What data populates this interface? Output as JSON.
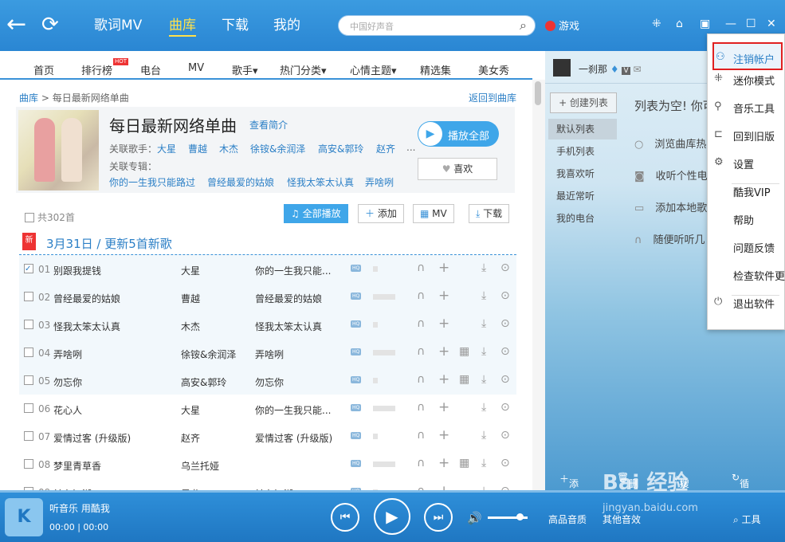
{
  "topbar": {
    "tabs": [
      "歌词MV",
      "曲库",
      "下载",
      "我的"
    ],
    "search_placeholder": "中国好声音",
    "game_label": "游戏"
  },
  "catbar": {
    "items": [
      "首页",
      "排行榜",
      "电台",
      "MV",
      "歌手▾",
      "热门分类▾",
      "心情主题▾",
      "精选集",
      "美女秀"
    ],
    "hot_badge": "HOT"
  },
  "main": {
    "breadcrumb_root": "曲库",
    "breadcrumb_sep": " > ",
    "breadcrumb_current": "每日最新网络单曲",
    "back_link": "返回到曲库",
    "title": "每日最新网络单曲",
    "intro_link": "查看简介",
    "related_singers_label": "关联歌手：",
    "related_singers": [
      "大星",
      "曹越",
      "木杰",
      "徐铵&余润泽",
      "高安&郭玲",
      "赵齐",
      "..."
    ],
    "related_albums_label": "关联专辑：",
    "related_albums": [
      "你的一生我只能路过",
      "曾经最爱的姑娘",
      "怪我太笨太认真",
      "弄啥咧"
    ],
    "play_all": "播放全部",
    "like": "喜欢",
    "count": "共302首",
    "toolbar": {
      "play_all": "全部播放",
      "add": "添加",
      "mv": "MV",
      "download": "下载"
    },
    "new_tag": "新",
    "date_title": "3月31日 / 更新5首新歌",
    "songs": [
      {
        "num": "01",
        "name": "别跟我提钱",
        "singer": "大星",
        "album": "你的一生我只能...",
        "mv": false
      },
      {
        "num": "02",
        "name": "曾经最爱的姑娘",
        "singer": "曹越",
        "album": "曾经最爱的姑娘",
        "mv": false
      },
      {
        "num": "03",
        "name": "怪我太笨太认真",
        "singer": "木杰",
        "album": "怪我太笨太认真",
        "mv": false
      },
      {
        "num": "04",
        "name": "弄啥咧",
        "singer": "徐铵&余润泽",
        "album": "弄啥咧",
        "mv": true
      },
      {
        "num": "05",
        "name": "勿忘你",
        "singer": "高安&郭玲",
        "album": "勿忘你",
        "mv": true
      },
      {
        "num": "06",
        "name": "花心人",
        "singer": "大星",
        "album": "你的一生我只能...",
        "mv": false
      },
      {
        "num": "07",
        "name": "爱情过客 (升级版)",
        "singer": "赵齐",
        "album": "爱情过客 (升级版)",
        "mv": false
      },
      {
        "num": "08",
        "name": "梦里青草香",
        "singer": "乌兰托娅",
        "album": "",
        "mv": true
      },
      {
        "num": "09",
        "name": "於在江湖",
        "singer": "黑龙",
        "album": "於在江湖",
        "mv": false
      }
    ]
  },
  "right": {
    "username": "一刹那",
    "create_list": "+ 创建列表",
    "lists": [
      "默认列表",
      "手机列表",
      "我喜欢听",
      "最近常听",
      "我的电台"
    ],
    "empty": "列表为空! 你可",
    "options": [
      "浏览曲库热",
      "收听个性电",
      "添加本地歌",
      "随便听听几"
    ],
    "bottom": [
      "添加",
      "删除",
      "搜索",
      "循环"
    ]
  },
  "menu": {
    "items": [
      {
        "icon": "person-icon",
        "label": "注销帐户"
      },
      {
        "icon": "mini-mode-icon",
        "label": "迷你模式"
      },
      {
        "icon": "tools-icon",
        "label": "音乐工具"
      },
      {
        "icon": "back-old-icon",
        "label": "回到旧版"
      },
      {
        "icon": "gear-icon",
        "label": "设置"
      },
      {
        "icon": "",
        "label": "酷我VIP"
      },
      {
        "icon": "",
        "label": "帮助"
      },
      {
        "icon": "",
        "label": "问题反馈"
      },
      {
        "icon": "",
        "label": "检查软件更"
      },
      {
        "icon": "power-icon",
        "label": "退出软件"
      }
    ]
  },
  "player": {
    "now_playing": "听音乐 用酷我",
    "time": "00:00 | 00:00",
    "quality": "高品音质",
    "quality2": "其他音效",
    "tools": "工具",
    "volume": 0.8
  },
  "watermark": {
    "text": "Bai 经验",
    "url": "jingyan.baidu.com"
  }
}
